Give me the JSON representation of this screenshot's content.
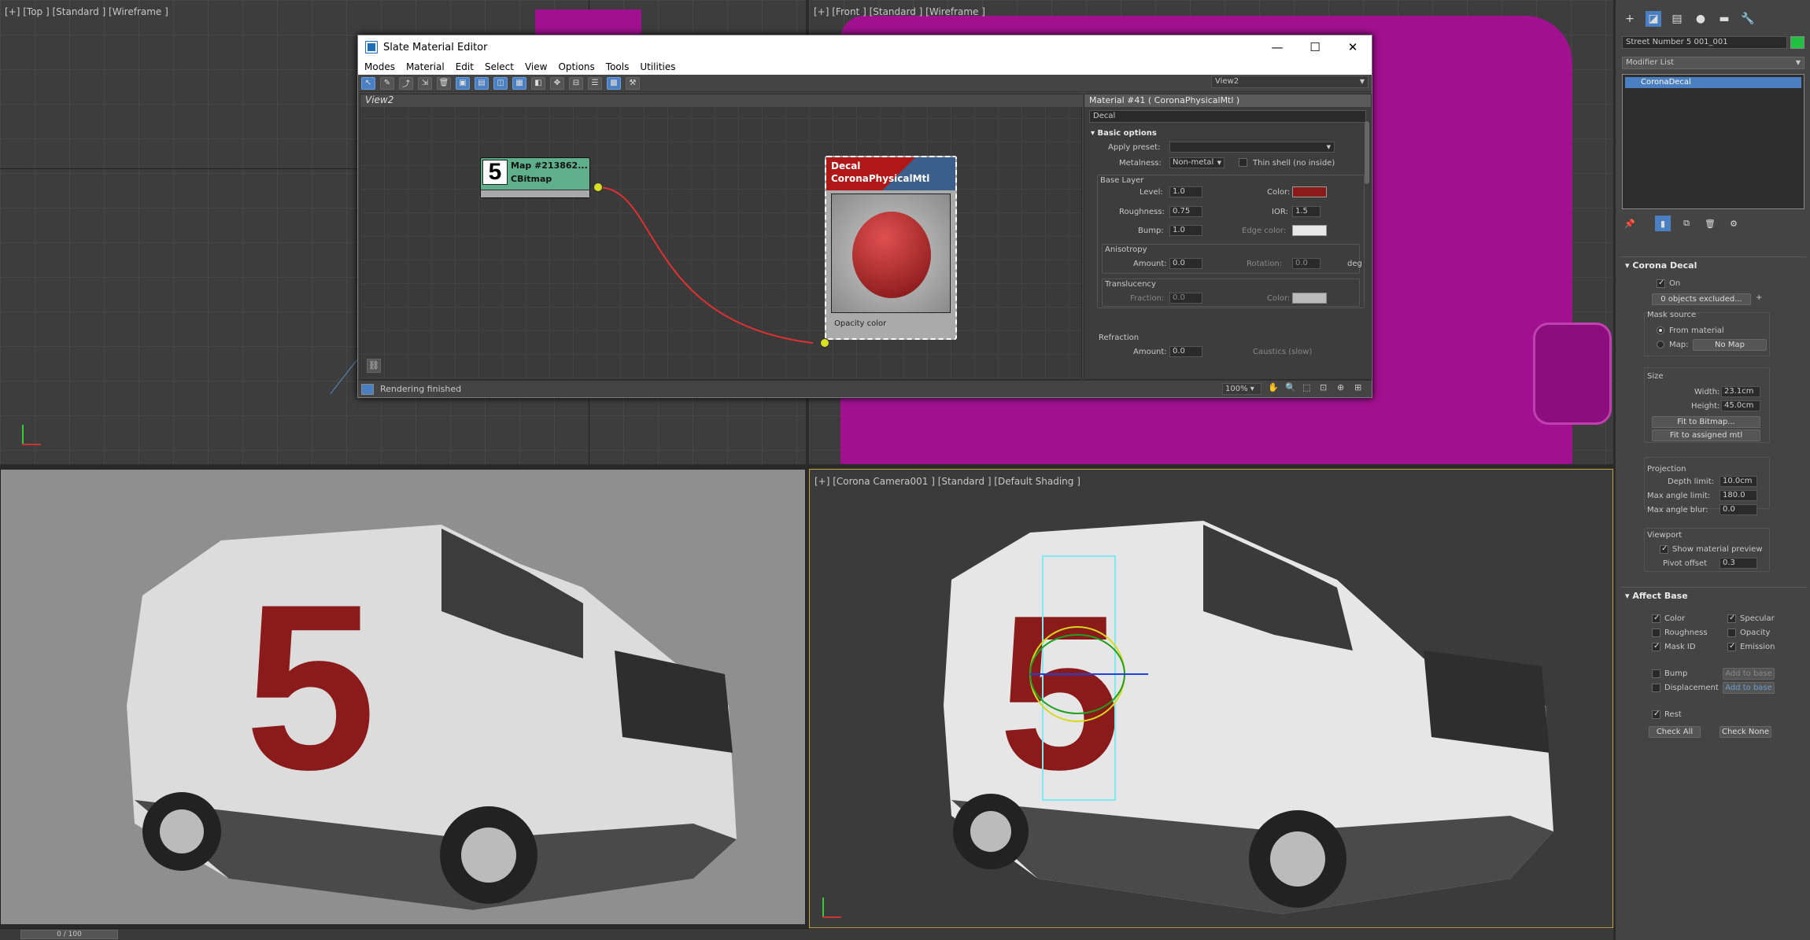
{
  "viewports": {
    "top": {
      "label": "[+] [Top ] [Standard ] [Wireframe ]"
    },
    "front": {
      "label": "[+] [Front ] [Standard ] [Wireframe ]"
    },
    "perspective": {
      "label": ""
    },
    "camera": {
      "label": "[+] [Corona Camera001 ] [Standard ] [Default Shading ]"
    }
  },
  "slate": {
    "title": "Slate Material Editor",
    "menu": [
      "Modes",
      "Material",
      "Edit",
      "Select",
      "View",
      "Options",
      "Tools",
      "Utilities"
    ],
    "view_select": "View2",
    "view_tab": "View2",
    "map_node": {
      "name": "Map #213862...",
      "type": "CBitmap"
    },
    "decal_node": {
      "name": "Decal",
      "type": "CoronaPhysicalMtl",
      "slot": "Opacity color"
    },
    "status": "Rendering finished",
    "zoom": "100%",
    "props": {
      "header": "Material #41  ( CoronaPhysicalMtl )",
      "name_field": "Decal",
      "basic_options": "Basic options",
      "apply_preset": "Apply preset:",
      "metalness_label": "Metalness:",
      "metalness_value": "Non-metal",
      "thin_shell": "Thin shell (no inside)",
      "base_layer": "Base Layer",
      "level_label": "Level:",
      "level": "1.0",
      "color_label": "Color:",
      "roughness_label": "Roughness:",
      "roughness": "0.75",
      "ior_label": "IOR:",
      "ior": "1.5",
      "bump_label": "Bump:",
      "bump": "1.0",
      "edge_color_label": "Edge color:",
      "anisotropy": "Anisotropy",
      "amount_label": "Amount:",
      "aniso_amount": "0.0",
      "rotation_label": "Rotation:",
      "rotation": "0.0",
      "deg": "deg",
      "translucency": "Translucency",
      "fraction_label": "Fraction:",
      "fraction": "0.0",
      "trans_color_label": "Color:",
      "refraction": "Refraction",
      "refr_amount": "0.0",
      "caustics": "Caustics (slow)"
    }
  },
  "command_panel": {
    "object_name": "Street Number 5 001_001",
    "modifier_list": "Modifier List",
    "stack_item": "CoronaDecal",
    "corona_decal": {
      "title": "Corona Decal",
      "on": "On",
      "excluded": "0 objects excluded...",
      "plus": "+",
      "mask_source": "Mask source",
      "from_material": "From material",
      "map_label": "Map:",
      "no_map": "No Map",
      "size": "Size",
      "width_label": "Width:",
      "width": "23.1cm",
      "height_label": "Height:",
      "height": "45.0cm",
      "fit_bitmap": "Fit to Bitmap...",
      "fit_mtl": "Fit to assigned mtl",
      "projection": "Projection",
      "depth_label": "Depth limit:",
      "depth": "10.0cm",
      "max_angle_label": "Max angle limit:",
      "max_angle": "180.0",
      "max_blur_label": "Max angle blur:",
      "max_blur": "0.0",
      "viewport": "Viewport",
      "show_preview": "Show material preview",
      "pivot_label": "Pivot offset",
      "pivot": "0.3"
    },
    "affect_base": {
      "title": "Affect Base",
      "color": "Color",
      "specular": "Specular",
      "roughness": "Roughness",
      "opacity": "Opacity",
      "mask_id": "Mask ID",
      "emission": "Emission",
      "bump": "Bump",
      "add_base_1": "Add to base",
      "displacement": "Displacement",
      "add_base_2": "Add to base",
      "rest": "Rest",
      "check_all": "Check All",
      "check_none": "Check None"
    }
  },
  "timeline": {
    "frame": "0 / 100"
  },
  "colors": {
    "magenta": "#a0108f",
    "decal_red": "#8b1a1a",
    "node_green": "#5fb08a",
    "accent_blue": "#4a7fc1"
  }
}
